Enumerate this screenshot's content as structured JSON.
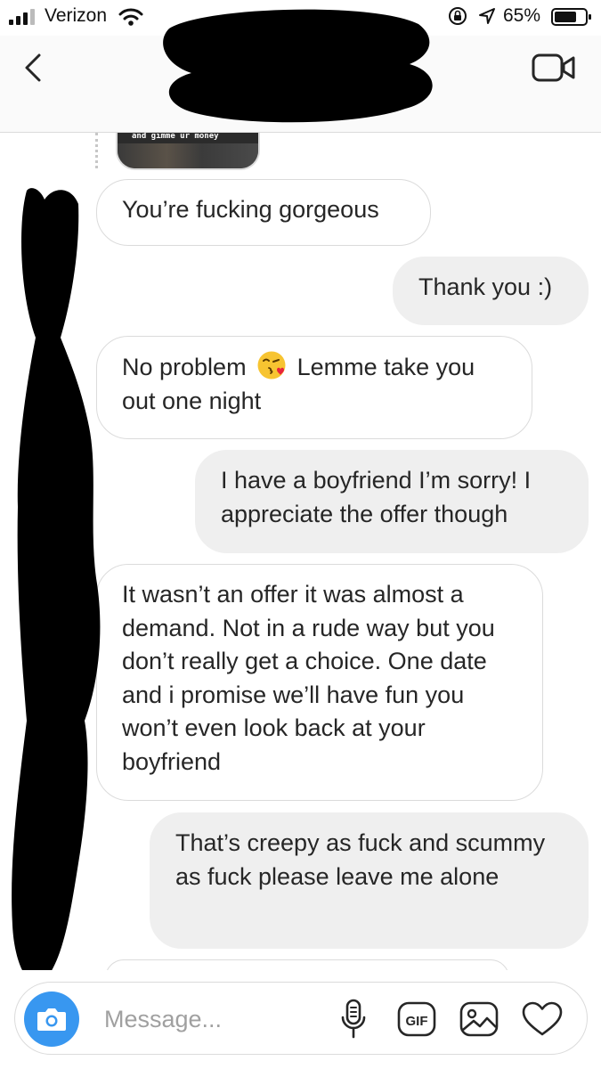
{
  "status_bar": {
    "carrier": "Verizon",
    "battery_percent": "65%"
  },
  "header": {
    "back_icon": "chevron-left-icon",
    "video_icon": "video-call-icon"
  },
  "story_reply": {
    "caption": "and gimme ur money"
  },
  "messages": [
    {
      "direction": "incoming",
      "text": "You’re fucking gorgeous"
    },
    {
      "direction": "outgoing",
      "text": "Thank you :)"
    },
    {
      "direction": "incoming",
      "text_before_emoji": "No problem",
      "emoji": "face-blowing-kiss",
      "text_after_emoji": "Lemme take you out one night"
    },
    {
      "direction": "outgoing",
      "text": "I have a boyfriend I’m sorry! I appreciate the offer though"
    },
    {
      "direction": "incoming",
      "text": "It wasn’t an offer it was almost a demand. Not in a rude way but you don’t really get a choice. One date and i promise we’ll have fun you won’t even look back at your boyfriend"
    },
    {
      "direction": "outgoing",
      "text": "That’s creepy as fuck and scummy as fuck please leave me alone"
    }
  ],
  "composer": {
    "placeholder": "Message...",
    "gif_label": "GIF",
    "icons": [
      "camera-icon",
      "microphone-icon",
      "gif-icon",
      "gallery-icon",
      "heart-icon"
    ]
  },
  "colors": {
    "camera_button": "#3897f0",
    "incoming_border": "#dbdbdb",
    "outgoing_fill": "#efefef",
    "redaction": "#000000"
  }
}
